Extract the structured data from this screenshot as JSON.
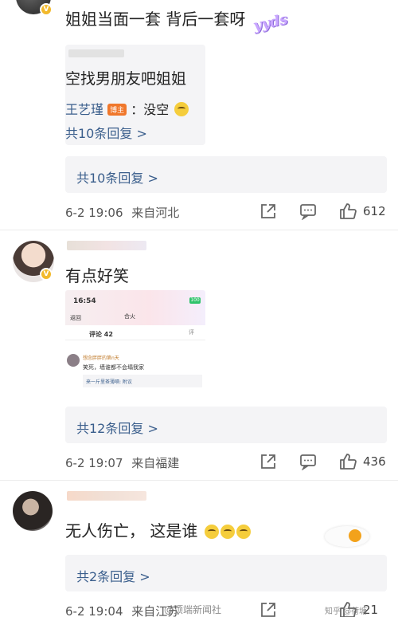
{
  "comment1": {
    "text": "姐姐当面一套 背后一套呀",
    "sticker": "yyds",
    "nested": {
      "text": "空找男朋友吧姐姐",
      "reply_user": "王艺瑾",
      "reply_badge": "博主",
      "reply_text": "：没空",
      "reply_count": "共10条回复 >"
    },
    "more_replies": "共10条回复 >",
    "time": "6-2 19:06",
    "location": "来自河北",
    "likes": "612"
  },
  "comment2": {
    "text": "有点好笑",
    "screenshot": {
      "time": "16:54",
      "battery": "100",
      "back": "返回",
      "title": "合火",
      "comments_header": "评论 42",
      "user": "想念胖胖的第n天",
      "text": "笑死，墙谁都不会塌我家",
      "reply": "来一斤里茶薄嗝: 附议",
      "top_right": "评"
    },
    "more_replies": "共12条回复 >",
    "time": "6-2 19:07",
    "location": "来自福建",
    "likes": "436"
  },
  "comment3": {
    "text": "无人伤亡，  这是谁",
    "more_replies": "共2条回复 >",
    "time": "6-2 19:04",
    "location": "来自江苏",
    "likes": "21"
  },
  "watermarks": {
    "left": "@顶端新闻社",
    "right": "知乎 @荷塘"
  },
  "colors": {
    "link": "#3a5e8c",
    "badge_orange": "#f0772b",
    "verified_gold": "#f2b92b"
  }
}
